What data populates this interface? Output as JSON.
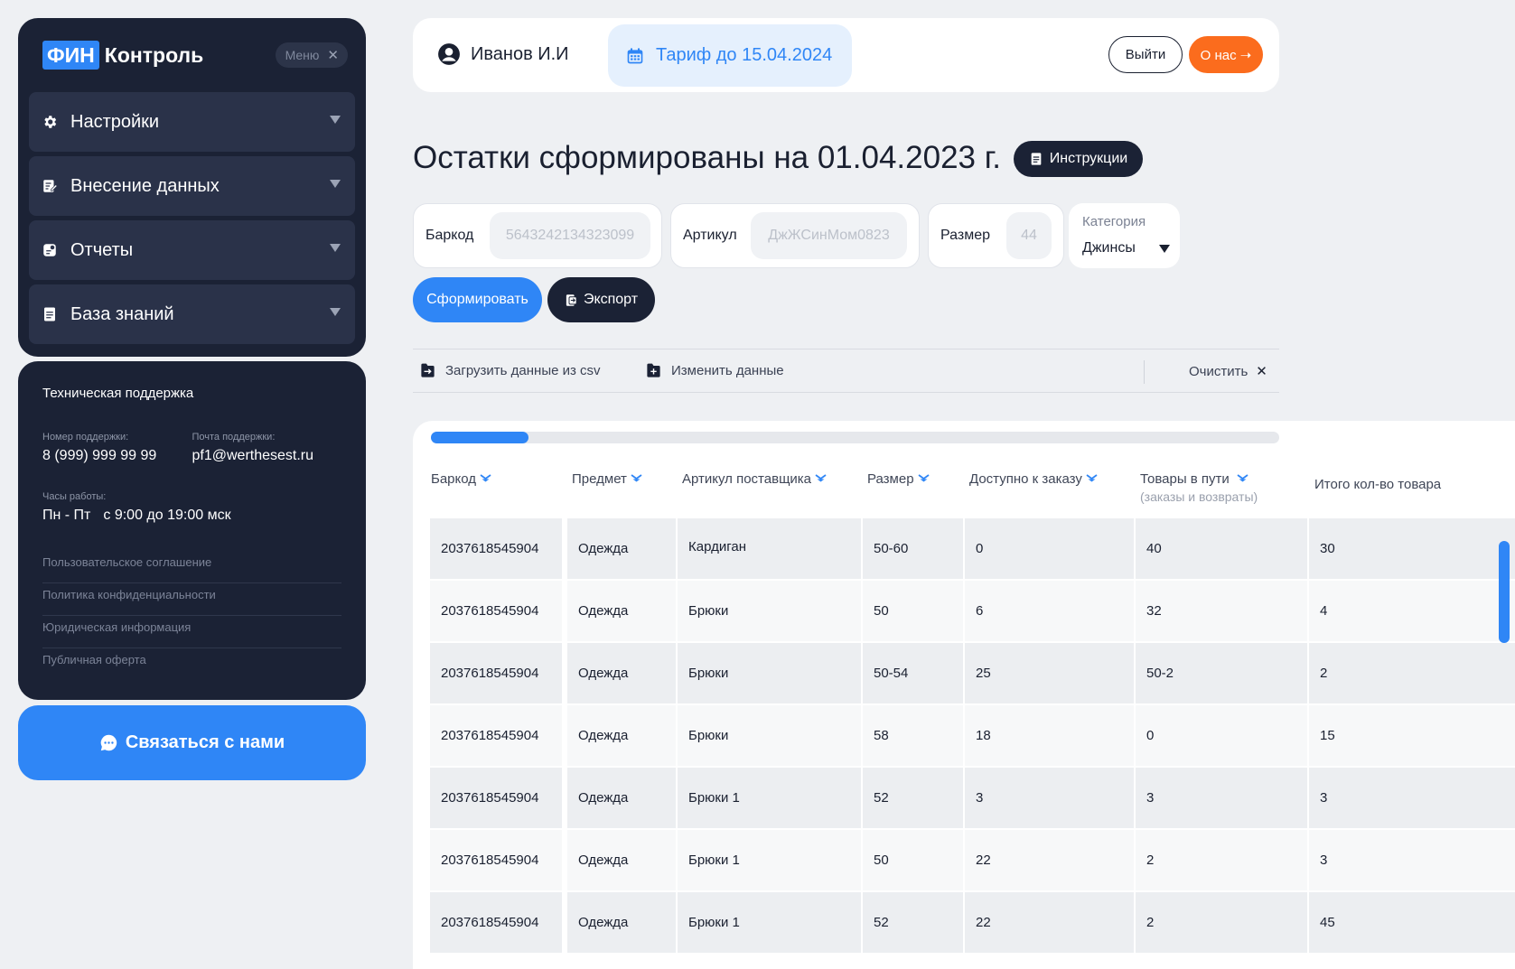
{
  "sidebar": {
    "brand": {
      "fin": "ФИН",
      "rest": "Контроль"
    },
    "menu_chip": {
      "label": "Меню",
      "close": "✕"
    },
    "items": [
      {
        "label": "Настройки",
        "icon": "gear-icon"
      },
      {
        "label": "Внесение данных",
        "icon": "edit-icon"
      },
      {
        "label": "Отчеты",
        "icon": "report-icon"
      },
      {
        "label": "База знаний",
        "icon": "book-icon"
      }
    ]
  },
  "support": {
    "title": "Техническая поддержка",
    "phone_label": "Номер поддержки:",
    "phone": "8 (999) 999 99 99",
    "email_label": "Почта поддержки:",
    "email": "pf1@werthesest.ru",
    "hours_label": "Часы работы:",
    "hours_days": "Пн - Пт",
    "hours_time": "с 9:00 до 19:00 мск",
    "links": [
      "Пользовательское соглашение",
      "Политика конфиденциальности",
      "Юридическая информация",
      "Публичная оферта"
    ]
  },
  "contact_button": "Связаться с нами",
  "topbar": {
    "user": "Иванов И.И",
    "tariff": "Тариф до 15.04.2024",
    "logout": "Выйти",
    "about": "О нас ➝"
  },
  "page_title": "Остатки сформированы на 01.04.2023 г.",
  "instructions_button": "Инструкции",
  "filters": {
    "barcode_label": "Баркод",
    "barcode_placeholder": "5643242134323099",
    "article_label": "Артикул",
    "article_placeholder": "ДжЖСинМом0823",
    "size_label": "Размер",
    "size_placeholder": "44",
    "category_label": "Категория",
    "category_value": "Джинсы"
  },
  "buttons": {
    "generate": "Сформировать",
    "export": "Экспорт"
  },
  "actions": {
    "upload_csv": "Загрузить данные из csv",
    "edit_data": "Изменить данные",
    "clear": "Очистить",
    "clear_icon": "✕"
  },
  "progress": 0.115,
  "table": {
    "headers": [
      {
        "label": "Баркод",
        "sub": ""
      },
      {
        "label": "Предмет",
        "sub": ""
      },
      {
        "label": "Артикул поставщика",
        "sub": ""
      },
      {
        "label": "Размер",
        "sub": ""
      },
      {
        "label": "Доступно к заказу",
        "sub": ""
      },
      {
        "label": "Товары в пути",
        "sub": "(заказы и возвраты)"
      },
      {
        "label": "Итого кол-во товара",
        "sub": ""
      }
    ],
    "rows": [
      [
        "2037618545904",
        "Одежда",
        "Кардиган",
        "50-60",
        "0",
        "40",
        "30"
      ],
      [
        "2037618545904",
        "Одежда",
        "Брюки",
        "50",
        "6",
        "32",
        "4"
      ],
      [
        "2037618545904",
        "Одежда",
        "Брюки",
        "50-54",
        "25",
        "50-2",
        "2"
      ],
      [
        "2037618545904",
        "Одежда",
        "Брюки",
        "58",
        "18",
        "0",
        "15"
      ],
      [
        "2037618545904",
        "Одежда",
        "Брюки 1",
        "52",
        "3",
        "3",
        "3"
      ],
      [
        "2037618545904",
        "Одежда",
        "Брюки 1",
        "50",
        "22",
        "2",
        "3"
      ],
      [
        "2037618545904",
        "Одежда",
        "Брюки 1",
        "52",
        "22",
        "2",
        "45"
      ]
    ]
  },
  "colors": {
    "accent": "#2f86f6",
    "dark": "#1b2235",
    "orange": "#fb6c1d",
    "background": "#eef0f3"
  }
}
